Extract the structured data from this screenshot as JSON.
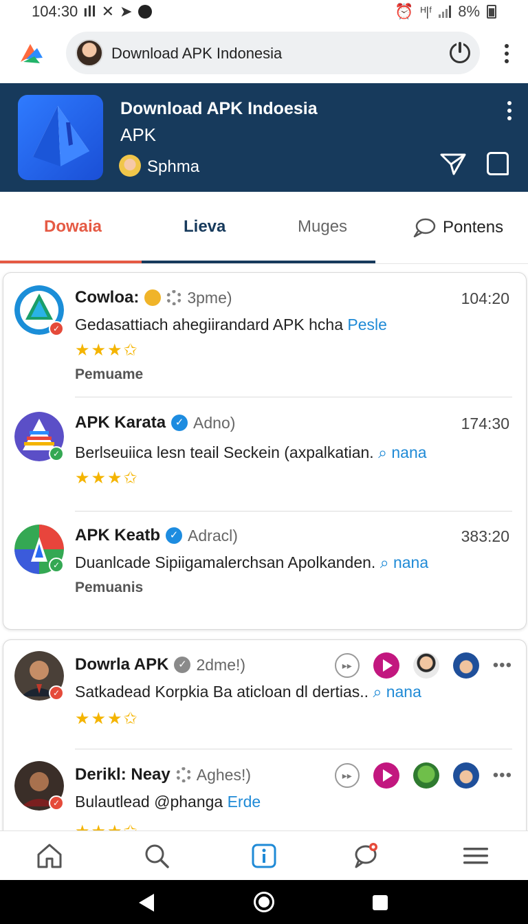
{
  "status_bar": {
    "time": "104:30",
    "battery": "8%"
  },
  "browser": {
    "url_title": "Download APK Indonesia"
  },
  "app": {
    "name": "Download APK Indoesia",
    "type": "APK",
    "developer": "Sphma"
  },
  "tabs": [
    {
      "label": "Dowaia"
    },
    {
      "label": "Lieva"
    },
    {
      "label": "Muges"
    },
    {
      "label": "Pontens"
    }
  ],
  "reviews": [
    {
      "name": "Cowloa:",
      "meta": "3pme)",
      "time": "104:20",
      "text": "Gedasattiach ahegiirandard APK hcha",
      "link": "Pesle",
      "stars": "★★★✩",
      "sub": "Pemuame"
    },
    {
      "name": "APK Karata",
      "meta": "Adno)",
      "time": "174:30",
      "text": "Berlseuiica lesn teail Seckein (axpalkatian.",
      "link": "nana",
      "stars": "★★★✩"
    },
    {
      "name": "APK Keatb",
      "meta": "Adracl)",
      "time": "383:20",
      "text": "Duanlcade Sipiigamalerchsan Apolkanden.",
      "link": "nana",
      "sub": "Pemuanis"
    },
    {
      "name": "Dowrla APK",
      "meta": "2dme!)",
      "text": "Satkadead Korpkia Ba aticloan dl dertias..",
      "link": "nana",
      "stars": "★★★✩"
    },
    {
      "name": "Derikl: Neay",
      "meta": "Aghes!)",
      "text": "Bulautlead @phanga",
      "link": "Erde",
      "stars": "★★★✩"
    }
  ],
  "colors": {
    "header_bg": "#173a5c",
    "accent_red": "#e55a44",
    "link_blue": "#1f8ad6",
    "star": "#f4b400",
    "play": "#c2177f"
  },
  "icons": {
    "bottom_nav": [
      "home-icon",
      "search-icon",
      "info-icon",
      "chat-icon",
      "menu-icon"
    ],
    "system_nav": [
      "back-icon",
      "home-circle-icon",
      "recents-icon"
    ]
  }
}
